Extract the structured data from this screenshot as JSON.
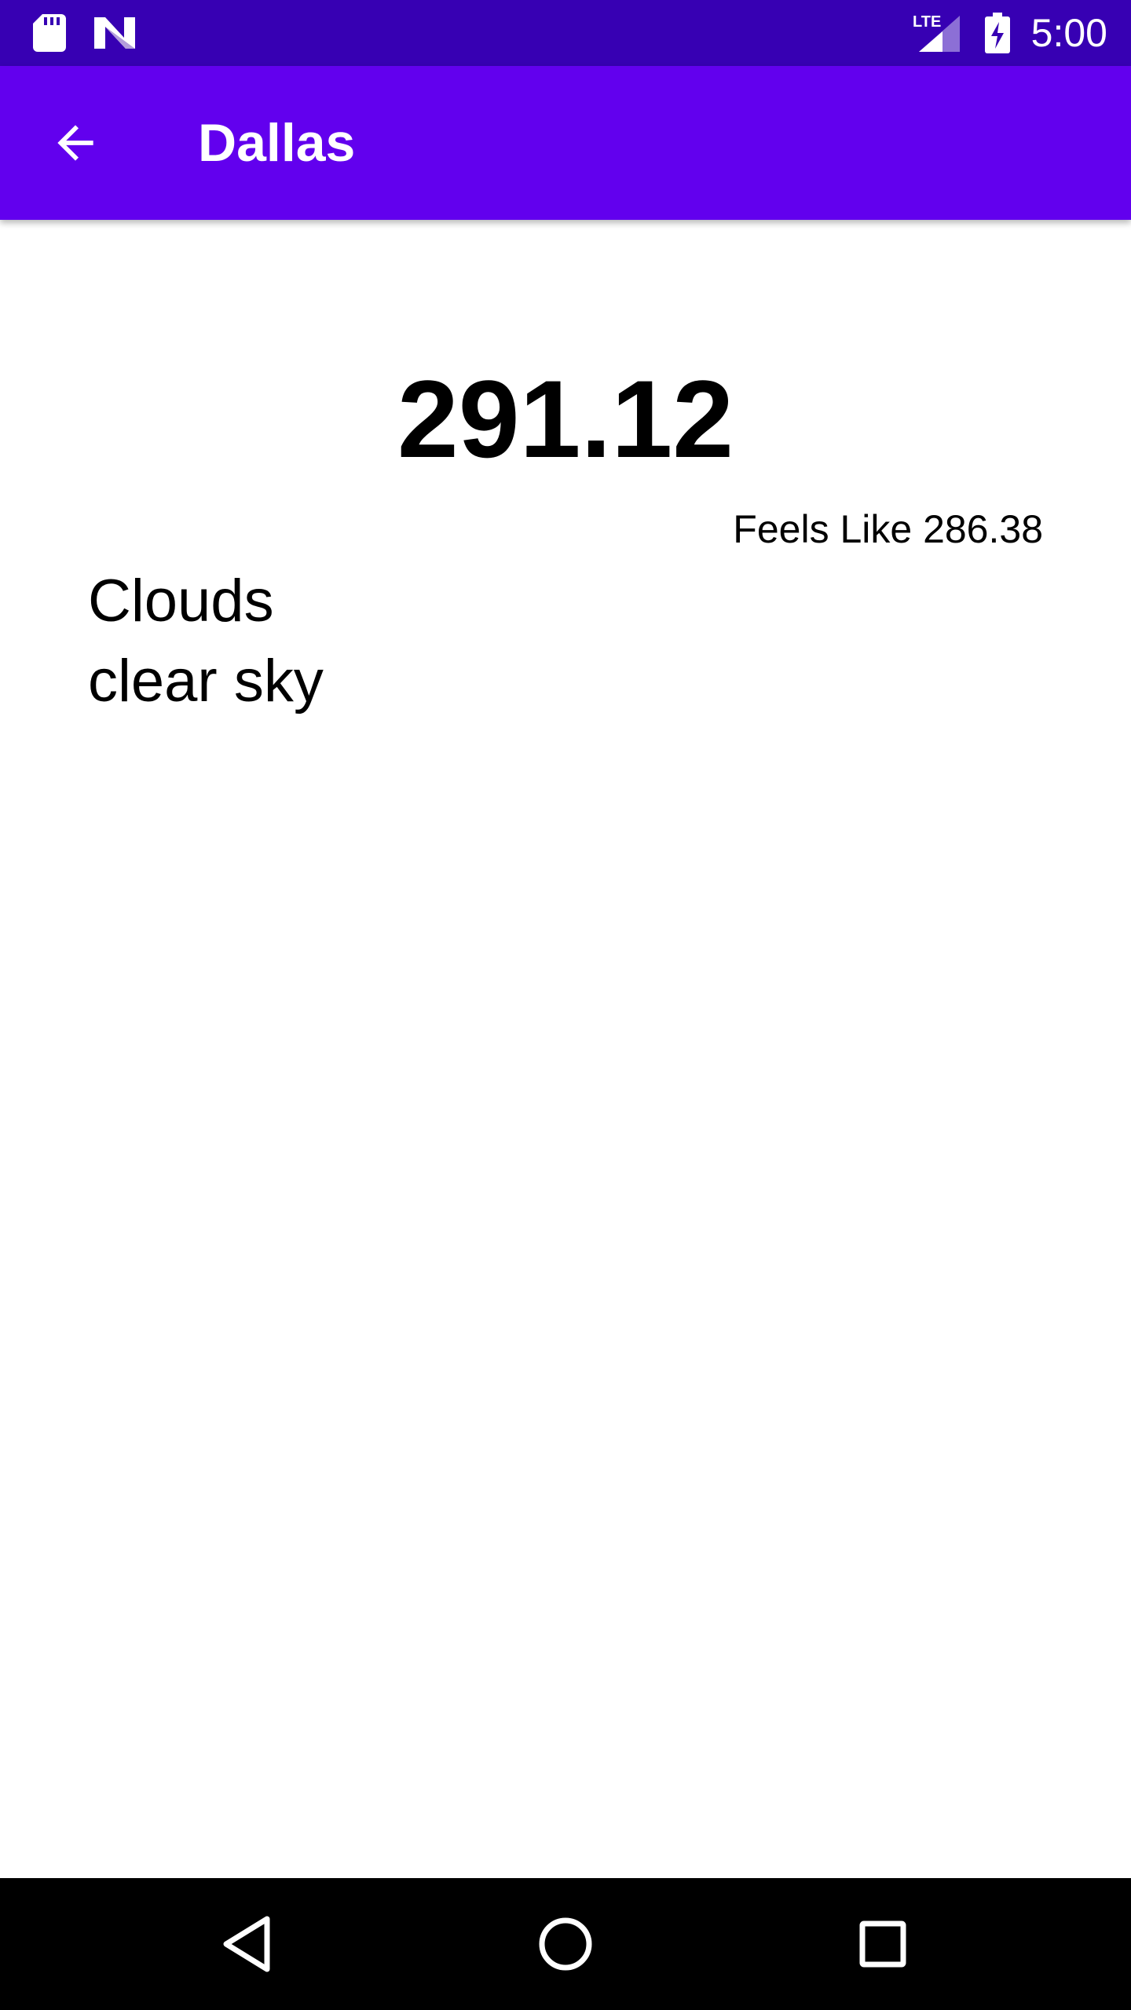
{
  "status_bar": {
    "time": "5:00",
    "network_label": "LTE",
    "icons": [
      "sd-card-icon",
      "n-notification-icon",
      "lte-signal-icon",
      "battery-charging-icon"
    ]
  },
  "app_bar": {
    "title": "Dallas",
    "back_icon": "arrow-back-icon"
  },
  "weather": {
    "temperature": "291.12",
    "feels_like": "Feels Like 286.38",
    "main": "Clouds",
    "description": "clear sky"
  },
  "navigation_bar": {
    "icons": [
      "back-triangle-icon",
      "home-circle-icon",
      "recents-square-icon"
    ]
  },
  "colors": {
    "status_bar": "#3700b3",
    "app_bar": "#6200ee",
    "background": "#ffffff",
    "nav_bar": "#000000"
  }
}
